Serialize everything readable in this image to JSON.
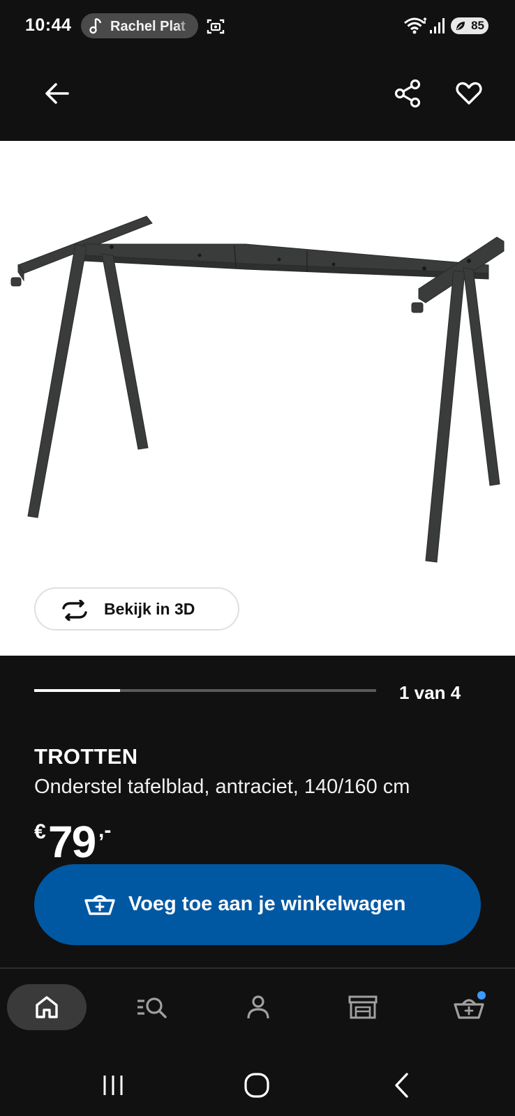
{
  "status_bar": {
    "time": "10:44",
    "now_playing": "Rachel Plat",
    "battery": "85"
  },
  "app_bar": {
    "back_icon": "arrow-left-icon",
    "share_icon": "share-icon",
    "favorite_icon": "heart-icon"
  },
  "gallery": {
    "view_3d_label": "Bekijk in 3D",
    "pager_text": "1 van 4",
    "progress_fraction": 0.25
  },
  "product": {
    "name": "TROTTEN",
    "description": "Onderstel tafelblad, antraciet, 140/160 cm",
    "price_currency": "€",
    "price_amount": "79",
    "price_suffix": ",-"
  },
  "add_to_cart": {
    "label": "Voeg toe aan je winkelwagen"
  },
  "bottom_nav": {
    "items": [
      {
        "icon": "home-icon",
        "active": true
      },
      {
        "icon": "search-list-icon",
        "active": false
      },
      {
        "icon": "person-icon",
        "active": false
      },
      {
        "icon": "store-icon",
        "active": false
      },
      {
        "icon": "cart-icon",
        "active": false,
        "badge_dot": true
      }
    ]
  },
  "colors": {
    "background": "#111111",
    "accent_blue": "#0058a3",
    "badge_dot": "#3b9bff"
  }
}
